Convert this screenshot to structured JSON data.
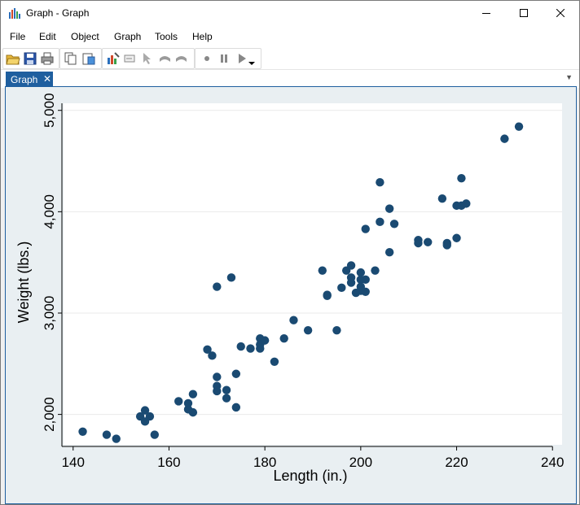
{
  "window": {
    "title": "Graph - Graph",
    "controls": {
      "minimize": "minimize-icon",
      "maximize": "maximize-icon",
      "close": "close-icon"
    }
  },
  "menu": [
    "File",
    "Edit",
    "Object",
    "Graph",
    "Tools",
    "Help"
  ],
  "toolbar": {
    "icons": [
      "open-icon",
      "save-icon",
      "print-icon",
      "copy-icon",
      "paste-icon",
      "graph-editor-icon",
      "rename-icon",
      "pointer-icon",
      "undo-icon",
      "redo-icon",
      "record-icon",
      "pause-icon",
      "play-icon",
      "dropdown-icon"
    ]
  },
  "tabs": [
    {
      "label": "Graph",
      "close": "✕"
    }
  ],
  "colors": {
    "marker": "#1a4a72",
    "tab": "#1f5f9f",
    "plot_bg": "#ffffff",
    "outer_bg": "#e9eff2",
    "grid": "#eaeaea"
  },
  "chart_data": {
    "type": "scatter",
    "xlabel": "Length (in.)",
    "ylabel": "Weight (lbs.)",
    "xlim": [
      138,
      242
    ],
    "ylim": [
      1700,
      5070
    ],
    "xticks": [
      140,
      160,
      180,
      200,
      220,
      240
    ],
    "xtick_labels": [
      "140",
      "160",
      "180",
      "200",
      "220",
      "240"
    ],
    "yticks": [
      2000,
      3000,
      4000,
      5000
    ],
    "ytick_labels": [
      "2,000",
      "3,000",
      "4,000",
      "5,000"
    ],
    "grid": "horizontal",
    "points": [
      [
        142,
        1830
      ],
      [
        147,
        1800
      ],
      [
        149,
        1760
      ],
      [
        154,
        1980
      ],
      [
        155,
        2040
      ],
      [
        155,
        1930
      ],
      [
        156,
        1980
      ],
      [
        157,
        1800
      ],
      [
        162,
        2130
      ],
      [
        164,
        2110
      ],
      [
        164,
        2050
      ],
      [
        165,
        2020
      ],
      [
        165,
        2200
      ],
      [
        168,
        2640
      ],
      [
        169,
        2580
      ],
      [
        170,
        2370
      ],
      [
        170,
        2280
      ],
      [
        170,
        2230
      ],
      [
        172,
        2240
      ],
      [
        172,
        2160
      ],
      [
        170,
        3260
      ],
      [
        173,
        3350
      ],
      [
        174,
        2400
      ],
      [
        174,
        2070
      ],
      [
        175,
        2670
      ],
      [
        177,
        2650
      ],
      [
        179,
        2750
      ],
      [
        179,
        2650
      ],
      [
        179,
        2690
      ],
      [
        180,
        2730
      ],
      [
        182,
        2520
      ],
      [
        184,
        2750
      ],
      [
        186,
        2930
      ],
      [
        189,
        2830
      ],
      [
        192,
        3420
      ],
      [
        193,
        3170
      ],
      [
        193,
        3180
      ],
      [
        195,
        2830
      ],
      [
        196,
        3250
      ],
      [
        197,
        3420
      ],
      [
        198,
        3470
      ],
      [
        198,
        3350
      ],
      [
        198,
        3300
      ],
      [
        199,
        3200
      ],
      [
        200,
        3400
      ],
      [
        200,
        3330
      ],
      [
        200,
        3260
      ],
      [
        200,
        3220
      ],
      [
        201,
        3210
      ],
      [
        201,
        3330
      ],
      [
        201,
        3830
      ],
      [
        203,
        3420
      ],
      [
        204,
        3900
      ],
      [
        204,
        4290
      ],
      [
        206,
        4030
      ],
      [
        206,
        3600
      ],
      [
        207,
        3880
      ],
      [
        212,
        3720
      ],
      [
        212,
        3690
      ],
      [
        214,
        3700
      ],
      [
        217,
        4130
      ],
      [
        218,
        3690
      ],
      [
        218,
        3670
      ],
      [
        220,
        4060
      ],
      [
        220,
        3740
      ],
      [
        221,
        4330
      ],
      [
        221,
        4060
      ],
      [
        222,
        4080
      ],
      [
        230,
        4720
      ],
      [
        233,
        4840
      ]
    ]
  }
}
